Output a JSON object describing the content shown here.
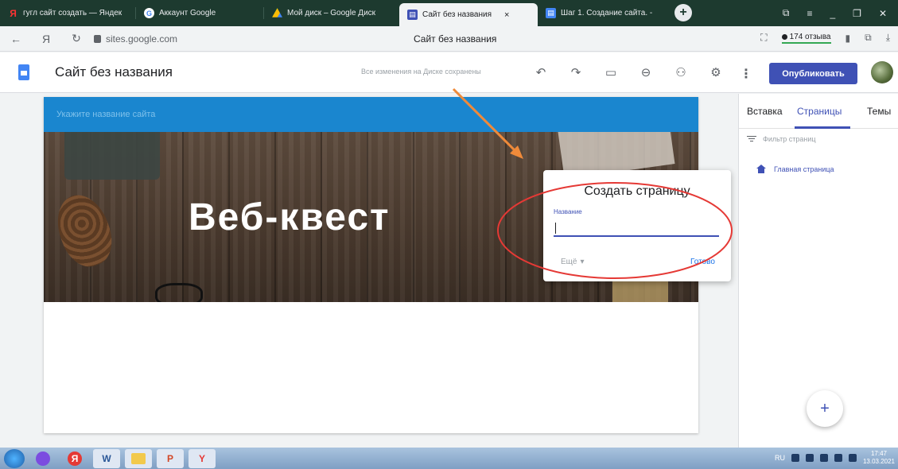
{
  "browser": {
    "tabs": [
      {
        "label": "гугл сайт создать — Яндек",
        "icon": "yandex-icon",
        "color": "#ff0000"
      },
      {
        "label": "Аккаунт Google",
        "icon": "google-icon",
        "color": "#4285f4"
      },
      {
        "label": "Мой диск – Google Диск",
        "icon": "google-drive-icon",
        "color": "#fbbc05"
      },
      {
        "label": "Сайт без названия",
        "icon": "google-sites-icon",
        "color": "#4285f4",
        "active": true,
        "close": "×"
      },
      {
        "label": "Шаг 1. Создание сайта. -",
        "icon": "google-docs-icon",
        "color": "#4285f4"
      }
    ],
    "new_tab": "+",
    "address": {
      "back": "←",
      "yandex_logo": "Я",
      "reload": "↻",
      "url": "sites.google.com",
      "page_title": "Сайт без названия",
      "reviews": "174 отзыва"
    }
  },
  "app": {
    "site_name": "Сайт без названия",
    "saved_note": "Все изменения на Диске сохранены",
    "publish_label": "Опубликовать",
    "toolbar_icons": [
      "undo-icon",
      "redo-icon",
      "device-preview-icon",
      "link-icon",
      "add-person-icon",
      "settings-icon"
    ]
  },
  "site": {
    "header_placeholder": "Укажите название сайта",
    "hero_title": "Веб-квест"
  },
  "dialog": {
    "title": "Создать страницу",
    "field_label": "Название",
    "field_value": "",
    "more_label": "Ещё",
    "done_label": "Готово"
  },
  "panel": {
    "tabs": [
      "Вставка",
      "Страницы",
      "Темы"
    ],
    "active_tab": "Страницы",
    "filter_placeholder": "Фильтр страниц",
    "pages": [
      "Главная страница"
    ]
  },
  "taskbar": {
    "lang": "RU",
    "time": "17:47",
    "date": "13.03.2021"
  },
  "colors": {
    "accent": "#3f51b5",
    "site_header": "#1a86cf",
    "browser_frame": "#1d3a2f",
    "annotation": "#e53935"
  }
}
